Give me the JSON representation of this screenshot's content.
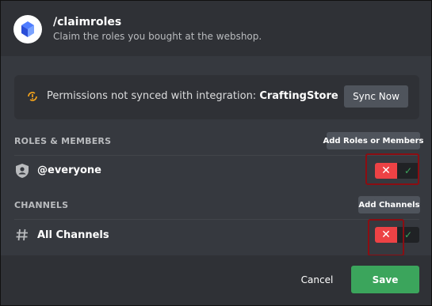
{
  "command": {
    "icon": "crafting-store-logo-icon",
    "title": "/claimroles",
    "description": "Claim the roles you bought at the webshop."
  },
  "notice": {
    "icon": "sync-warning-icon",
    "text": "Permissions not synced with integration:",
    "integration": "CraftingStore",
    "sync_button": "Sync Now"
  },
  "roles_section": {
    "label": "ROLES & MEMBERS",
    "add_button": "Add Roles or Members",
    "items": [
      {
        "icon": "shield-user-icon",
        "label": "@everyone",
        "deny_icon": "close-icon",
        "allow_icon": "check-icon",
        "state": "denied"
      }
    ]
  },
  "channels_section": {
    "label": "CHANNELS",
    "add_button": "Add Channels",
    "items": [
      {
        "icon": "hash-icon",
        "label": "All Channels",
        "deny_icon": "close-icon",
        "allow_icon": "check-icon",
        "state": "denied"
      }
    ]
  },
  "footer": {
    "cancel": "Cancel",
    "save": "Save"
  },
  "colors": {
    "background": "#36393f",
    "panel": "#2f3136",
    "deny": "#ed4245",
    "allow": "#3ba55c",
    "button": "#4f545c",
    "highlight": "#8b0d12"
  }
}
